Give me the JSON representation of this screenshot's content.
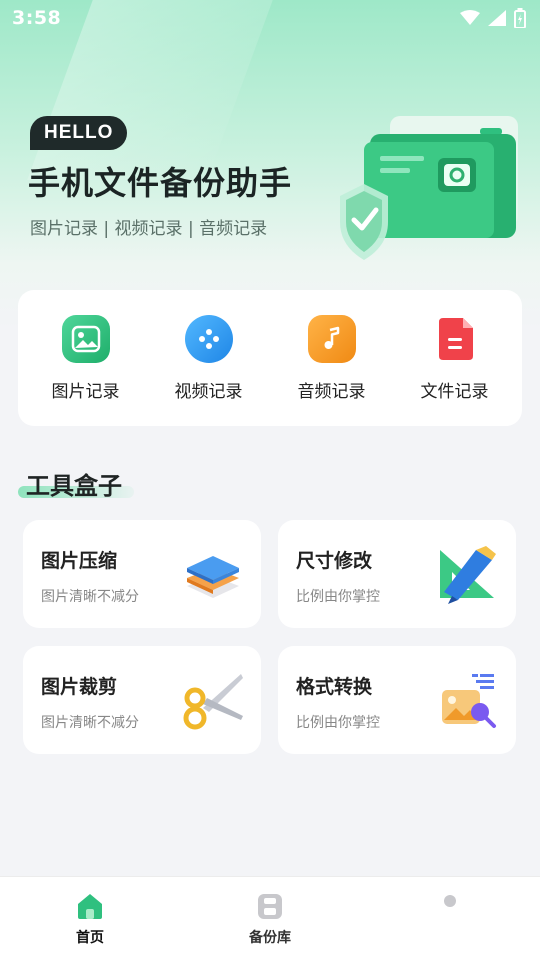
{
  "status_bar": {
    "time": "3:58"
  },
  "hero": {
    "badge": "HELLO",
    "title": "手机文件备份助手",
    "subtitle": "图片记录 | 视频记录 | 音频记录"
  },
  "quick_actions": [
    {
      "label": "图片记录",
      "icon": "image-icon",
      "color": "#2fc07f"
    },
    {
      "label": "视频记录",
      "icon": "video-reel-icon",
      "color": "#2f9bf0"
    },
    {
      "label": "音频记录",
      "icon": "music-note-icon",
      "color": "#f5951f"
    },
    {
      "label": "文件记录",
      "icon": "document-icon",
      "color": "#f0424a"
    }
  ],
  "tools_section": {
    "title": "工具盒子",
    "items": [
      {
        "title": "图片压缩",
        "desc": "图片清晰不减分",
        "icon": "layers-icon"
      },
      {
        "title": "尺寸修改",
        "desc": "比例由你掌控",
        "icon": "ruler-icon"
      },
      {
        "title": "图片裁剪",
        "desc": "图片清晰不减分",
        "icon": "scissors-icon"
      },
      {
        "title": "格式转换",
        "desc": "比例由你掌控",
        "icon": "convert-image-icon"
      }
    ]
  },
  "bottom_nav": {
    "items": [
      {
        "label": "首页",
        "icon": "home-icon",
        "active": true
      },
      {
        "label": "备份库",
        "icon": "backup-icon",
        "active": false
      },
      {
        "label": "",
        "icon": "profile-icon",
        "active": false
      }
    ]
  },
  "colors": {
    "accent": "#2fc07f",
    "background": "#f3f4f7"
  }
}
